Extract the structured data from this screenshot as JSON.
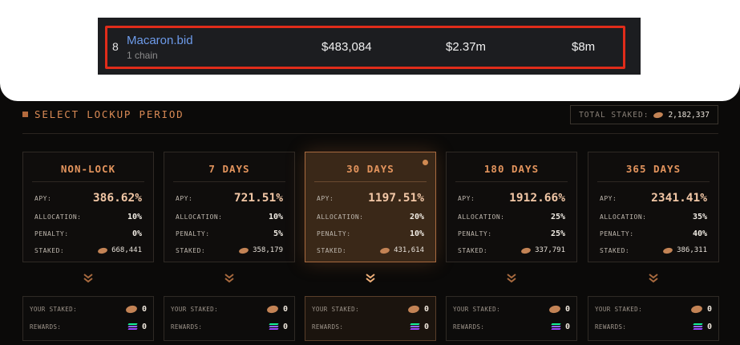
{
  "leaderboard_row": {
    "rank": "8",
    "name": "Macaron.bid",
    "chains": "1 chain",
    "col1": "$483,084",
    "col2": "$2.37m",
    "col3": "$8m"
  },
  "header": {
    "title": "SELECT LOCKUP PERIOD",
    "total_label": "TOTAL STAKED:",
    "total_value": "2,182,337"
  },
  "labels": {
    "apy": "APY:",
    "allocation": "ALLOCATION:",
    "penalty": "PENALTY:",
    "staked": "STAKED:",
    "your_staked": "YOUR STAKED:",
    "rewards": "REWARDS:"
  },
  "tiers": [
    {
      "title": "NON-LOCK",
      "apy": "386.62%",
      "allocation": "10%",
      "penalty": "0%",
      "staked": "668,441",
      "your_staked": "0",
      "rewards": "0",
      "selected": false
    },
    {
      "title": "7 DAYS",
      "apy": "721.51%",
      "allocation": "10%",
      "penalty": "5%",
      "staked": "358,179",
      "your_staked": "0",
      "rewards": "0",
      "selected": false
    },
    {
      "title": "30 DAYS",
      "apy": "1197.51%",
      "allocation": "20%",
      "penalty": "10%",
      "staked": "431,614",
      "your_staked": "0",
      "rewards": "0",
      "selected": true
    },
    {
      "title": "180 DAYS",
      "apy": "1912.66%",
      "allocation": "25%",
      "penalty": "25%",
      "staked": "337,791",
      "your_staked": "0",
      "rewards": "0",
      "selected": false
    },
    {
      "title": "365 DAYS",
      "apy": "2341.41%",
      "allocation": "35%",
      "penalty": "40%",
      "staked": "386,311",
      "your_staked": "0",
      "rewards": "0",
      "selected": false
    }
  ],
  "icons": {
    "token": "bronze-token-icon",
    "reward": "solana-icon",
    "chevron": "double-chevron-down-icon",
    "selected_indicator": "selected-dot-icon"
  },
  "colors": {
    "accent": "#e3945d",
    "highlight_border": "#e02c1a",
    "link": "#6d9bea"
  }
}
